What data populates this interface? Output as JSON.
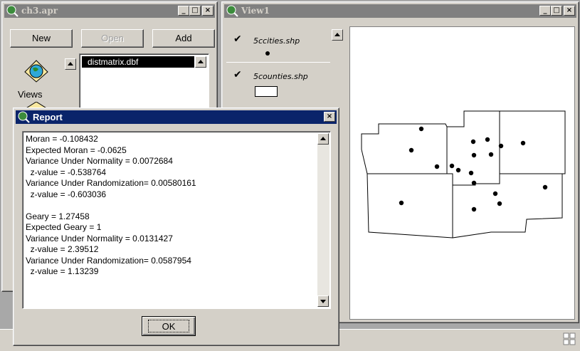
{
  "project_window": {
    "title": "ch3.apr",
    "buttons": {
      "new": "New",
      "open": "Open",
      "add": "Add"
    },
    "doc_type": "Views",
    "documents": [
      "distmatrix.dbf"
    ]
  },
  "view_window": {
    "title": "View1",
    "themes": [
      {
        "name": "5ccities.shp",
        "checked": true,
        "symbol": "point"
      },
      {
        "name": "5counties.shp",
        "checked": true,
        "symbol": "polygon"
      }
    ],
    "map": {
      "city_points": 18
    }
  },
  "report_dialog": {
    "title": "Report",
    "lines": [
      "Moran = -0.108432",
      "Expected Moran = -0.0625",
      "Variance Under Normality = 0.0072684",
      "  z-value = -0.538764",
      "Variance Under Randomization= 0.00580161",
      "  z-value = -0.603036",
      "",
      "Geary = 1.27458",
      "Expected Geary = 1",
      "Variance Under Normality = 0.0131427",
      "  z-value = 2.39512",
      "Variance Under Randomization= 0.0587954",
      "  z-value = 1.13239"
    ],
    "ok_label": "OK"
  },
  "colors": {
    "active_title": "#0a246a",
    "inactive_title": "#808080",
    "face": "#d4d0c8"
  }
}
